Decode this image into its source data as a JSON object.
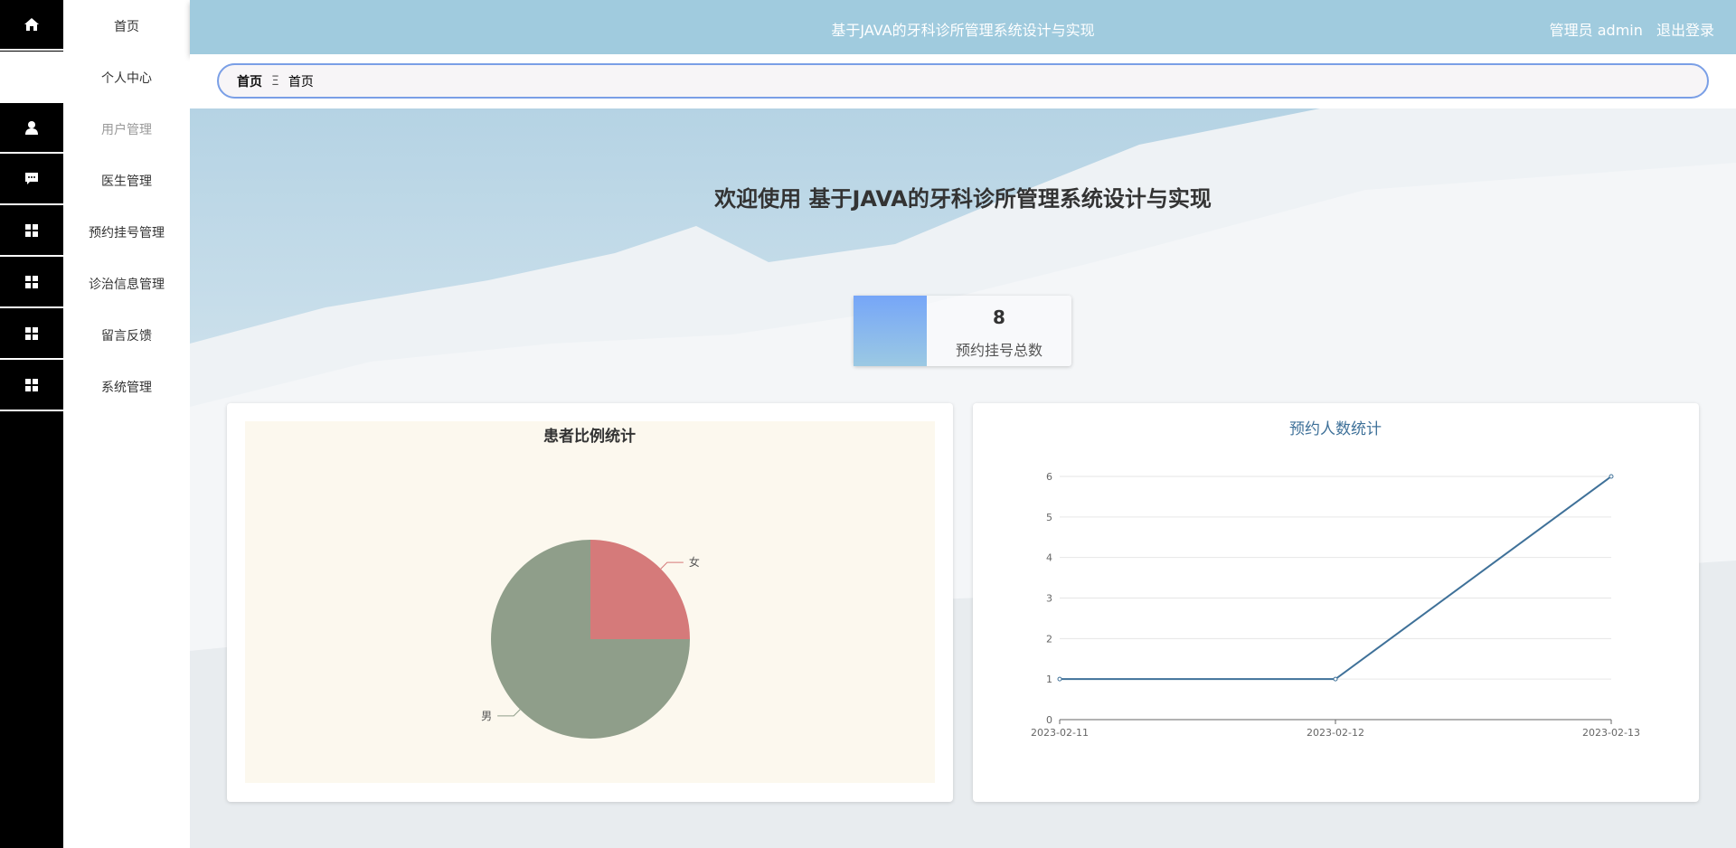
{
  "sidebar": {
    "items": [
      {
        "label": "首页",
        "icon": "home-icon"
      },
      {
        "label": "个人中心",
        "icon": ""
      },
      {
        "label": "用户管理",
        "icon": "user-icon"
      },
      {
        "label": "医生管理",
        "icon": "chat-icon"
      },
      {
        "label": "预约挂号管理",
        "icon": "grid-icon"
      },
      {
        "label": "诊治信息管理",
        "icon": "grid-icon"
      },
      {
        "label": "留言反馈",
        "icon": "grid-icon"
      },
      {
        "label": "系统管理",
        "icon": "grid-icon"
      }
    ]
  },
  "header": {
    "title": "基于JAVA的牙科诊所管理系统设计与实现",
    "user": "管理员 admin",
    "logout": "退出登录"
  },
  "breadcrumb": {
    "root": "首页",
    "separator": "Ξ",
    "current": "首页"
  },
  "welcome": "欢迎使用 基于JAVA的牙科诊所管理系统设计与实现",
  "stat": {
    "value": "8",
    "label": "预约挂号总数"
  },
  "chart_data": [
    {
      "type": "pie",
      "title": "患者比例统计",
      "labels": [
        "女",
        "男"
      ],
      "values": [
        2,
        6
      ],
      "colors": [
        "#d57a7a",
        "#8f9e8a"
      ]
    },
    {
      "type": "line",
      "title": "预约人数统计",
      "x": [
        "2023-02-11",
        "2023-02-12",
        "2023-02-13"
      ],
      "values": [
        1,
        1,
        6
      ],
      "ylim": [
        0,
        6
      ],
      "yticks": [
        "0",
        "1",
        "2",
        "3",
        "4",
        "5",
        "6"
      ],
      "color": "#3f7199"
    }
  ]
}
